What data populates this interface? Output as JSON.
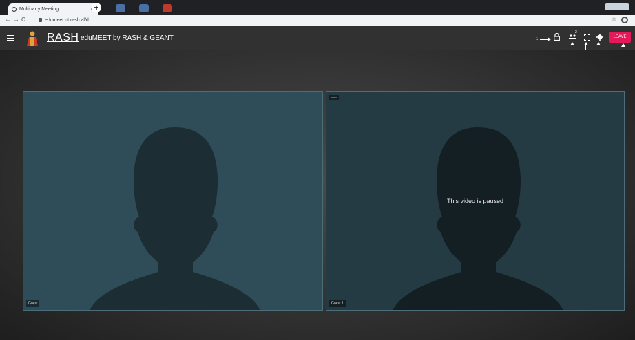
{
  "browser": {
    "tab_title": "Multiparty Meeting",
    "tab_close": "×",
    "new_tab": "+",
    "url": "edumeet.ut.rash.al/d",
    "back": "←",
    "forward": "→",
    "reload": "C",
    "bookmark": "☆"
  },
  "app": {
    "brand": "RASH",
    "title": "eduMEET by RASH & GEANT",
    "leave_label": "LEAVE",
    "participants_badge": "2",
    "colors": {
      "leave": "#e5195a",
      "appbar": "#313131",
      "tile": "#2f4d58"
    }
  },
  "annotations": [
    "1",
    "2",
    "3",
    "4",
    "5"
  ],
  "peers": [
    {
      "name": "Guest",
      "top_label": ""
    },
    {
      "name": "Guest 1",
      "top_label": "user",
      "overlay": "This video is paused"
    }
  ],
  "icons": [
    "menu-icon",
    "lock-icon",
    "participants-icon",
    "fullscreen-icon",
    "settings-icon"
  ]
}
